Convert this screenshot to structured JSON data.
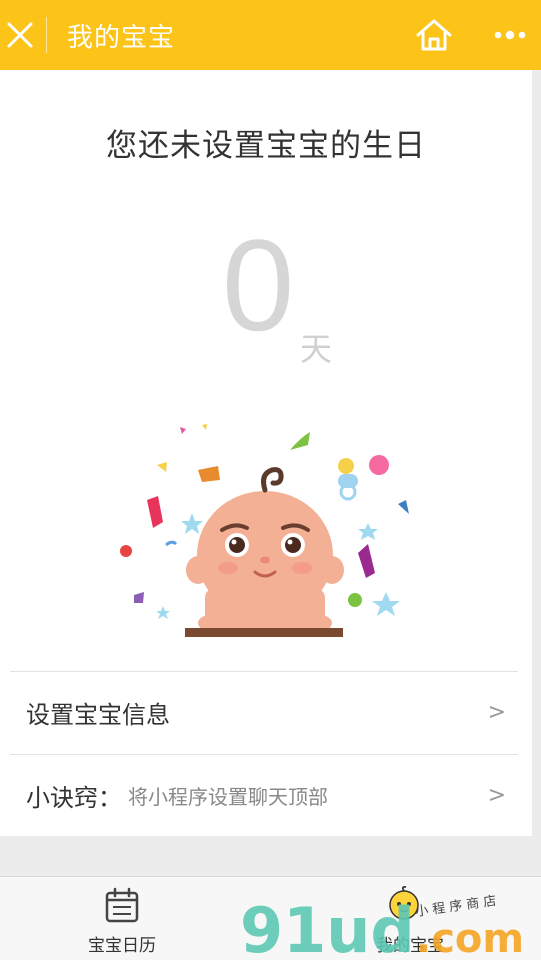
{
  "header": {
    "title": "我的宝宝",
    "close_icon": "close-icon",
    "home_icon": "home-icon",
    "more_icon": "more-dots-icon",
    "bg_color": "#fcc318"
  },
  "main": {
    "headline": "您还未设置宝宝的生日",
    "days_count": "0",
    "days_unit": "天",
    "illustration": "baby-illustration"
  },
  "rows": [
    {
      "label": "设置宝宝信息",
      "hint": "",
      "chevron": ">"
    },
    {
      "label": "小诀窍：",
      "hint": "将小程序设置聊天顶部",
      "chevron": ">"
    }
  ],
  "tabbar": {
    "tabs": [
      {
        "label": "宝宝日历",
        "icon": "calendar-icon",
        "active": false
      },
      {
        "label": "我的宝宝",
        "icon": "baby-face-icon",
        "active": true
      }
    ]
  },
  "watermark": {
    "brand": "91ud.com",
    "subtitle": "小程序商店"
  }
}
